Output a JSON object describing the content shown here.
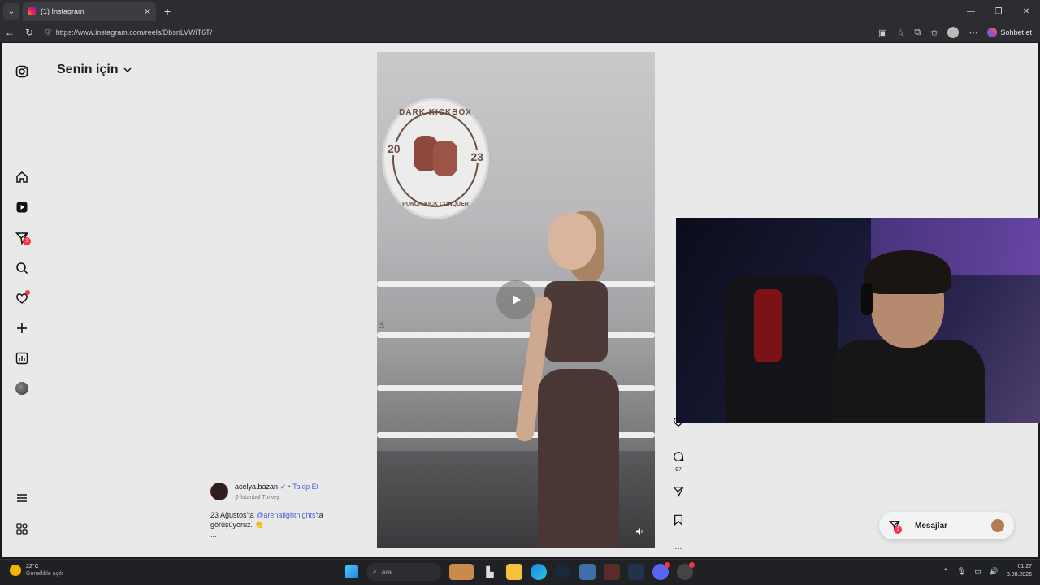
{
  "browser": {
    "tab_title": "(1) Instagram",
    "url": "https://www.instagram.com/reels/DbsnLVWiT6T/",
    "chat_button": "Sohbet et"
  },
  "instagram": {
    "page_title": "Senin için",
    "nav_badge": "1",
    "reel": {
      "username": "acelya.bazan",
      "follow_label": "Takip Et",
      "location": "İstanbul Turkey",
      "caption_prefix": "23 Ağustos'ta",
      "caption_mention": "@arenafightnights",
      "caption_suffix": "'ta görüşüyoruz. 👏",
      "caption_more": "...",
      "comment_count": "97",
      "more_label": "...",
      "overlay_logo_top": "DARK KICKBOX",
      "overlay_logo_year_left": "20",
      "overlay_logo_year_right": "23",
      "overlay_logo_bottom": "PUNCH KICK CONQUER"
    },
    "messages": {
      "label": "Mesajlar",
      "badge": "1"
    }
  },
  "taskbar": {
    "weather_temp": "22°C",
    "weather_desc": "Genellikle açık",
    "search_placeholder": "Ara",
    "time": "01:27",
    "date": "8.08.2026"
  },
  "colors": {
    "accent_link": "#4a63d6",
    "badge_red": "#ff3040"
  }
}
